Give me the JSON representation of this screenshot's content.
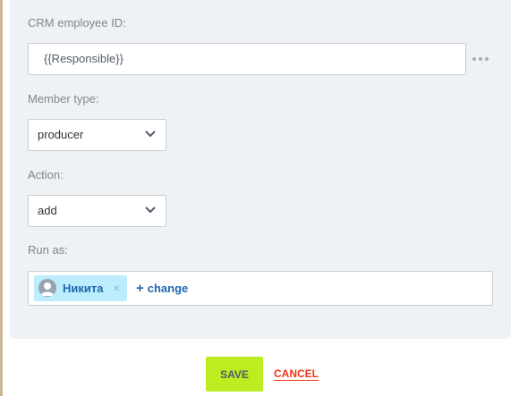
{
  "form": {
    "employee_id": {
      "label": "CRM employee ID:",
      "value": "{{Responsible}}",
      "more_icon": "more-dots-icon"
    },
    "member_type": {
      "label": "Member type:",
      "selected": "producer"
    },
    "action": {
      "label": "Action:",
      "selected": "add"
    },
    "run_as": {
      "label": "Run as:",
      "user_name": "Никита",
      "remove_icon": "×",
      "change_plus": "+",
      "change_label": "change"
    }
  },
  "footer": {
    "save_label": "SAVE",
    "cancel_label": "CANCEL"
  },
  "colors": {
    "panel_bg": "#eef2f4",
    "save_bg": "#bbed21",
    "cancel": "#f1361b",
    "link": "#2067b0",
    "chip_bg": "#bcedfc"
  }
}
